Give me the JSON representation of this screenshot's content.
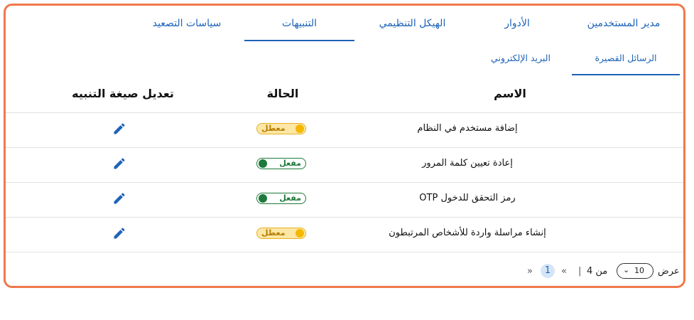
{
  "tabs": [
    {
      "label": "مدير المستخدمين",
      "active": false
    },
    {
      "label": "الأدوار",
      "active": false
    },
    {
      "label": "الهيكل التنظيمي",
      "active": false
    },
    {
      "label": "التنبيهات",
      "active": true
    },
    {
      "label": "سياسات التصعيد",
      "active": false
    }
  ],
  "sub_tabs": [
    {
      "label": "الرسائل القصيرة",
      "active": true
    },
    {
      "label": "البريد الإلكتروني",
      "active": false
    }
  ],
  "table": {
    "headers": {
      "name": "الاسم",
      "status": "الحالة",
      "edit": "تعديل صيغة التنبيه"
    },
    "rows": [
      {
        "name": "إضافة مستخدم في النظام",
        "status": "معطل",
        "enabled": false
      },
      {
        "name": "إعادة تعيين كلمة المرور",
        "status": "مفعل",
        "enabled": true
      },
      {
        "name": "OTP رمز التحقق للدخول",
        "status": "مفعل",
        "enabled": true
      },
      {
        "name": "إنشاء مراسلة واردة للأشخاص المرتبطون",
        "status": "معطل",
        "enabled": false
      }
    ]
  },
  "pagination": {
    "show_label": "عرض",
    "page_size": "10",
    "of_label": "من 4",
    "separator": "|",
    "prev": "«",
    "current_page": "1",
    "next": "»"
  },
  "colors": {
    "accent": "#1d63b8",
    "frame": "#f0784a",
    "on": "#1e7a3a",
    "off": "#f5b800"
  }
}
